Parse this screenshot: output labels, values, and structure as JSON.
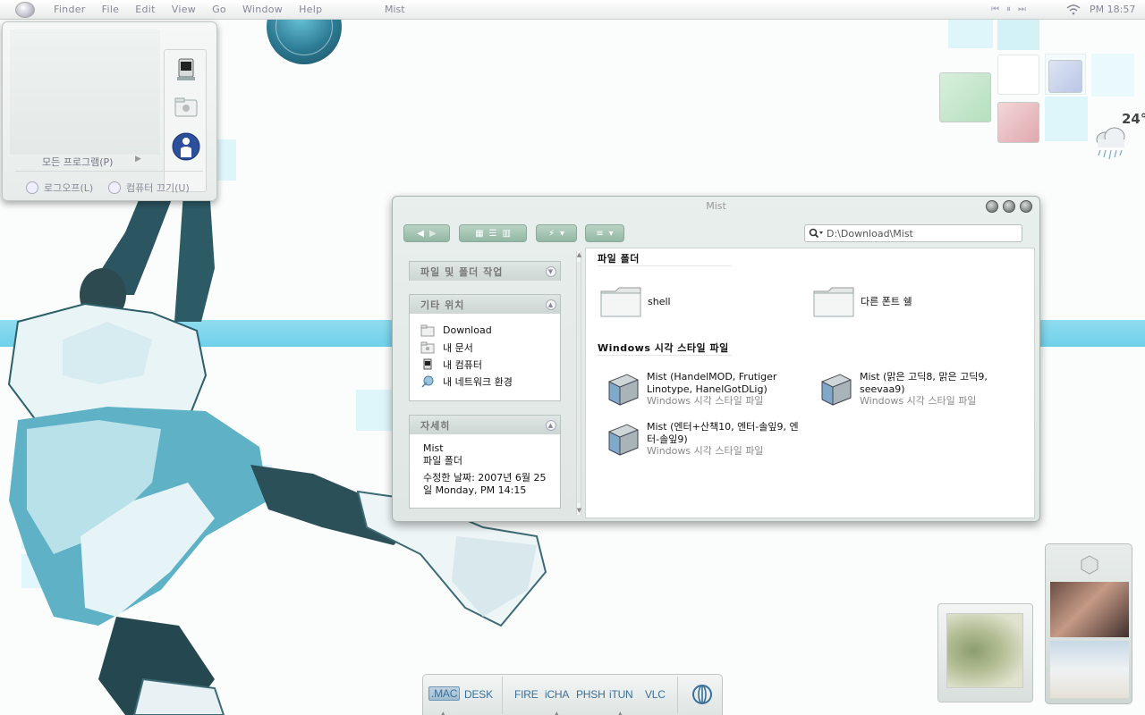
{
  "menubar": {
    "items": [
      "Finder",
      "File",
      "Edit",
      "View",
      "Go",
      "Window",
      "Help"
    ],
    "active_window": "Mist",
    "media": [
      "⏮",
      "⏸",
      "⏭"
    ],
    "clock": "PM 18:57"
  },
  "start_panel": {
    "all_programs": "모든 프로그램(P)",
    "logoff": "로그오프(L)",
    "shutdown": "컴퓨터 끄기(U)"
  },
  "weather": {
    "temperature": "24°"
  },
  "finder": {
    "title": "Mist",
    "address": "D:\\Download\\Mist",
    "tasks": {
      "file_folder_tasks": "파일 및 폴더 작업",
      "other_places": "기타 위치",
      "details": "자세히"
    },
    "places": [
      "Download",
      "내 문서",
      "내 컴퓨터",
      "내 네트워크 환경"
    ],
    "details": {
      "name": "Mist",
      "type": "파일 폴더",
      "modified": "수정한 날짜: 2007년 6월 25일 Monday, PM 14:15"
    },
    "groups": {
      "folders": "파일 폴더",
      "styles": "Windows 시각 스타일 파일"
    },
    "folders": [
      "shell",
      "다른 폰트 쉘"
    ],
    "files": [
      {
        "name": "Mist (HandelMOD, Frutiger Linotype, HanelGotDLig)",
        "type": "Windows 시각 스타일 파일"
      },
      {
        "name": "Mist (맑은 고딕8, 맑은 고딕9, seevaa9)",
        "type": "Windows 시각 스타일 파일"
      },
      {
        "name": "Mist (엔터+산책10, 엔터-솔잎9, 엔터-솔잎9)",
        "type": "Windows 시각 스타일 파일"
      }
    ]
  },
  "dock": {
    "items": [
      ".MAC",
      "DESK",
      "FIRE",
      "iCHA",
      "PHSH",
      "iTUN",
      "VLC"
    ],
    "active": ".MAC"
  },
  "colors": {
    "accent_teal": "#6fd0ea",
    "toolbar_green": "#93b8a5",
    "dock_text": "#3a6f98"
  }
}
